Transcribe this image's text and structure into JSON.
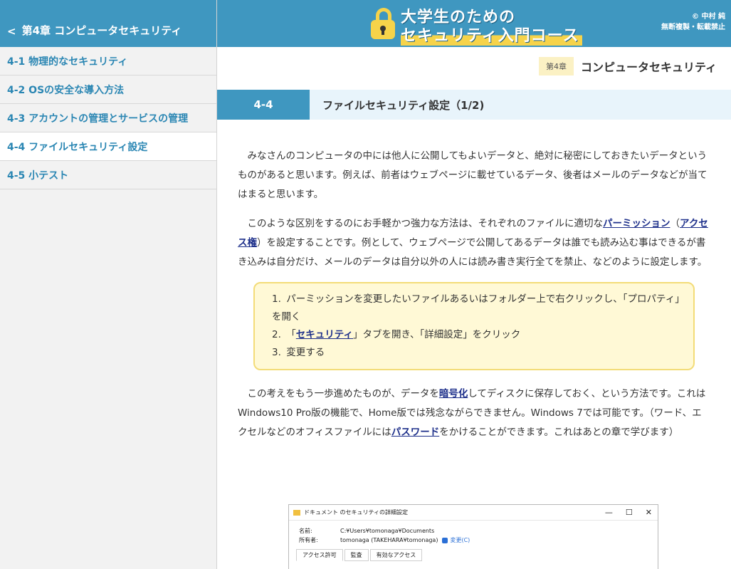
{
  "sidebar": {
    "back_label": "第4章 コンピュータセキュリティ",
    "items": [
      {
        "label": "4-1 物理的なセキュリティ"
      },
      {
        "label": "4-2 OSの安全な導入方法"
      },
      {
        "label": "4-3 アカウントの管理とサービスの管理"
      },
      {
        "label": "4-4 ファイルセキュリティ設定"
      },
      {
        "label": "4-5 小テスト"
      }
    ],
    "active_index": 3
  },
  "header": {
    "logo_line1": "大学生のための",
    "logo_line2": "セキュリティ入門コース",
    "copyright_line1": "© 中村 純",
    "copyright_line2": "無断複製・転載禁止"
  },
  "chapter": {
    "badge": "第4章",
    "title": "コンピュータセキュリティ"
  },
  "section": {
    "number": "4-4",
    "title": "ファイルセキュリティ設定（1/2)"
  },
  "content": {
    "p1": "みなさんのコンピュータの中には他人に公開してもよいデータと、絶対に秘密にしておきたいデータというものがあると思います。例えば、前者はウェブページに載せているデータ、後者はメールのデータなどが当てはまると思います。",
    "p2_a": "このような区別をするのにお手軽かつ強力な方法は、それぞれのファイルに適切な",
    "p2_link1": "パーミッション",
    "p2_b": "（",
    "p2_link2": "アクセス権",
    "p2_c": "）を設定することです。例として、ウェブページで公開してあるデータは誰でも読み込む事はできるが書き込みは自分だけ、メールのデータは自分以外の人には読み書き実行全てを禁止、などのように設定します。",
    "steps": [
      {
        "num": "1.",
        "text": "パーミッションを変更したいファイルあるいはフォルダー上で右クリックし、「プロパティ」を開く"
      },
      {
        "num": "2.",
        "pre": "「",
        "link": "セキュリティ",
        "post": "」タブを開き、「詳細設定」をクリック"
      },
      {
        "num": "3.",
        "text": "変更する"
      }
    ],
    "p3_a": "この考えをもう一歩進めたものが、データを",
    "p3_link1": "暗号化",
    "p3_b": "してディスクに保存しておく、という方法です。これはWindows10 Pro版の機能で、Home版では残念ながらできません。Windows 7では可能です。（ワード、エクセルなどのオフィスファイルには",
    "p3_link2": "パスワード",
    "p3_c": "をかけることができます。これはあとの章で学びます）"
  },
  "screenshot": {
    "window_title": "ドキュメント のセキュリティの詳細設定",
    "name_label": "名前:",
    "name_value": "C:¥Users¥tomonaga¥Documents",
    "owner_label": "所有者:",
    "owner_value": "tomonaga (TAKEHARA¥tomonaga)",
    "change_link": "変更(C)",
    "tabs": [
      "アクセス許可",
      "監査",
      "有効なアクセス"
    ],
    "controls": [
      "—",
      "☐",
      "✕"
    ]
  }
}
